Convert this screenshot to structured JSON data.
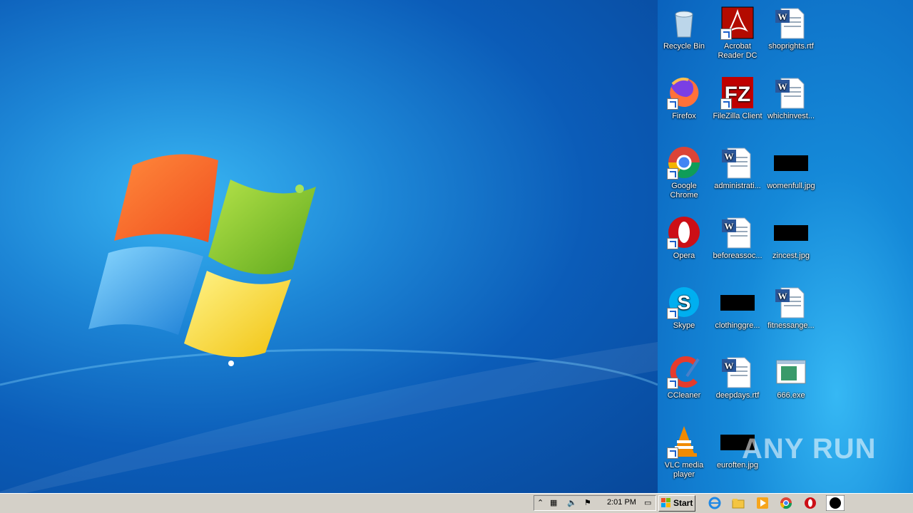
{
  "desktop": {
    "icons": [
      {
        "label": "Recycle Bin",
        "icon": "recycle-bin-icon"
      },
      {
        "label": "Acrobat Reader DC",
        "icon": "acrobat-icon"
      },
      {
        "label": "shoprights.rtf",
        "icon": "word-doc-icon"
      },
      {
        "label": "Firefox",
        "icon": "firefox-icon"
      },
      {
        "label": "FileZilla Client",
        "icon": "filezilla-icon"
      },
      {
        "label": "whichinvest...",
        "icon": "word-doc-icon"
      },
      {
        "label": "Google Chrome",
        "icon": "chrome-icon"
      },
      {
        "label": "administrati...",
        "icon": "word-doc-icon"
      },
      {
        "label": "womenfull.jpg",
        "icon": "image-thumbnail-icon"
      },
      {
        "label": "Opera",
        "icon": "opera-icon"
      },
      {
        "label": "beforeassoc...",
        "icon": "word-doc-icon"
      },
      {
        "label": "zincest.jpg",
        "icon": "image-thumbnail-icon"
      },
      {
        "label": "Skype",
        "icon": "skype-icon"
      },
      {
        "label": "clothinggre...",
        "icon": "image-thumbnail-icon"
      },
      {
        "label": "fitnessange...",
        "icon": "word-doc-icon"
      },
      {
        "label": "CCleaner",
        "icon": "ccleaner-icon"
      },
      {
        "label": "deepdays.rtf",
        "icon": "word-doc-icon"
      },
      {
        "label": "666.exe",
        "icon": "exe-icon"
      },
      {
        "label": "VLC media player",
        "icon": "vlc-icon"
      },
      {
        "label": "euroften.jpg",
        "icon": "image-thumbnail-icon"
      }
    ]
  },
  "taskbar": {
    "start_label": "Start",
    "clock": "2:01 PM"
  },
  "watermark": "ANY RUN"
}
